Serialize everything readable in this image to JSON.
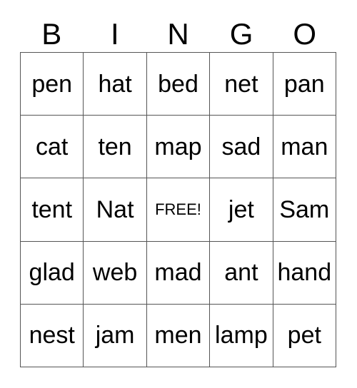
{
  "card": {
    "header": {
      "letters": [
        "B",
        "I",
        "N",
        "G",
        "O"
      ]
    },
    "grid": {
      "columns": 5,
      "rows": 5,
      "line_color": "#555555",
      "text_color": "#000000",
      "background_color": "#ffffff",
      "cells": [
        [
          {
            "text": "pen",
            "free": false
          },
          {
            "text": "hat",
            "free": false
          },
          {
            "text": "bed",
            "free": false
          },
          {
            "text": "net",
            "free": false
          },
          {
            "text": "pan",
            "free": false
          }
        ],
        [
          {
            "text": "cat",
            "free": false
          },
          {
            "text": "ten",
            "free": false
          },
          {
            "text": "map",
            "free": false
          },
          {
            "text": "sad",
            "free": false
          },
          {
            "text": "man",
            "free": false
          }
        ],
        [
          {
            "text": "tent",
            "free": false
          },
          {
            "text": "Nat",
            "free": false
          },
          {
            "text": "FREE!",
            "free": true
          },
          {
            "text": "jet",
            "free": false
          },
          {
            "text": "Sam",
            "free": false
          }
        ],
        [
          {
            "text": "glad",
            "free": false
          },
          {
            "text": "web",
            "free": false
          },
          {
            "text": "mad",
            "free": false
          },
          {
            "text": "ant",
            "free": false
          },
          {
            "text": "hand",
            "free": false
          }
        ],
        [
          {
            "text": "nest",
            "free": false
          },
          {
            "text": "jam",
            "free": false
          },
          {
            "text": "men",
            "free": false
          },
          {
            "text": "lamp",
            "free": false
          },
          {
            "text": "pet",
            "free": false
          }
        ]
      ]
    }
  }
}
